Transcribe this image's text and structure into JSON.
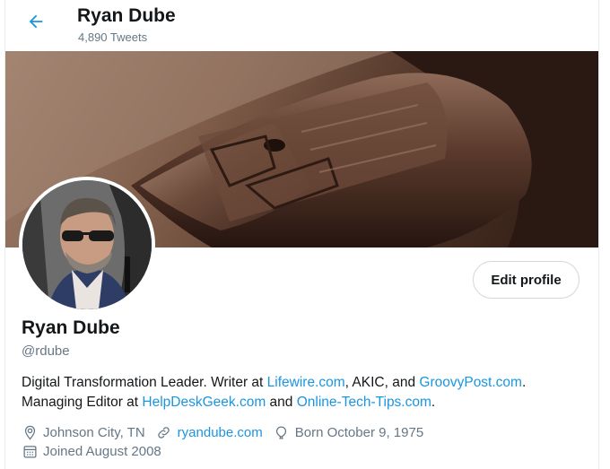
{
  "header": {
    "name": "Ryan Dube",
    "tweet_count": "4,890 Tweets"
  },
  "profile": {
    "name": "Ryan Dube",
    "handle": "@rdube",
    "edit_label": "Edit profile",
    "bio": {
      "t1": "Digital Transformation Leader. Writer at ",
      "link1": "Lifewire.com",
      "t2": ", AKIC, and ",
      "link2": "GroovyPost.com",
      "t3": ".",
      "t4": "Managing Editor at ",
      "link3": "HelpDeskGeek.com",
      "t5": " and ",
      "link4": "Online-Tech-Tips.com",
      "t6": "."
    },
    "meta": {
      "location": "Johnson City, TN",
      "website": "ryandube.com",
      "birthday": "Born October 9, 1975",
      "joined": "Joined August 2008"
    }
  },
  "icons": {
    "back": "back-arrow-icon",
    "location": "location-pin-icon",
    "website": "link-icon",
    "birthday": "balloon-icon",
    "joined": "calendar-icon"
  },
  "colors": {
    "accent": "#1b95e0",
    "secondary_text": "#657786",
    "primary_text": "#14171a"
  }
}
